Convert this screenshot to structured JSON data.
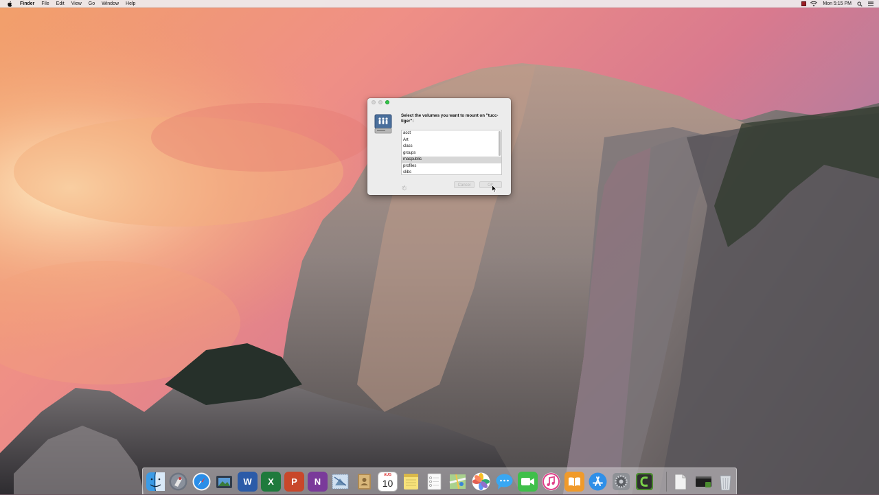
{
  "menubar": {
    "app_name": "Finder",
    "items": [
      "File",
      "Edit",
      "View",
      "Go",
      "Window",
      "Help"
    ],
    "clock": "Mon 5:15 PM"
  },
  "dialog": {
    "prompt": "Select the volumes you want to mount on \"tucc-tiger\":",
    "volumes": [
      "acct",
      "Art",
      "class",
      "groups",
      "macpublic",
      "profiles",
      "slibs"
    ],
    "selected_volume": "macpublic",
    "cancel_label": "Cancel",
    "ok_label": "OK"
  },
  "dock": {
    "calendar": {
      "month": "AUG",
      "day": "10"
    }
  }
}
